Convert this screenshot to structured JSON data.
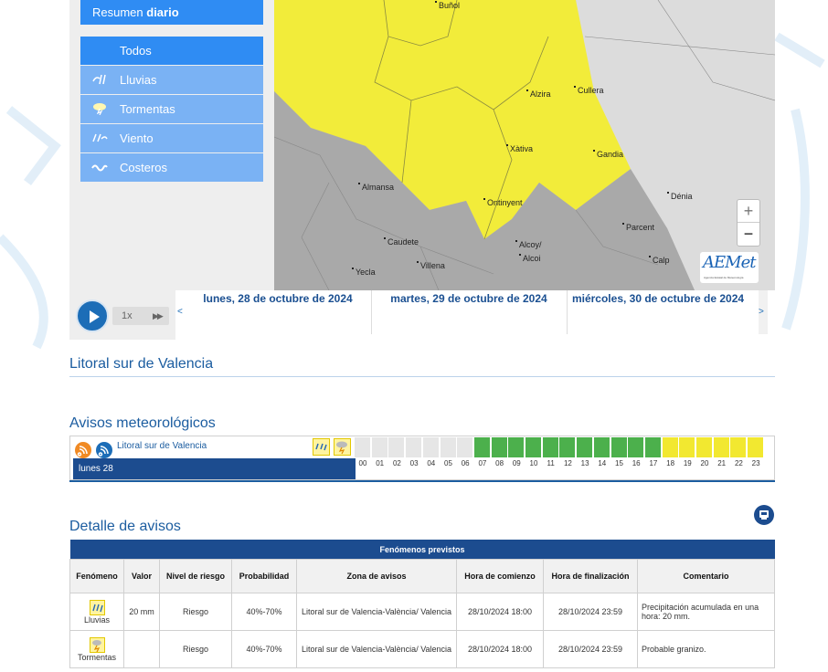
{
  "sidebar": {
    "summary_prefix": "Resumen ",
    "summary_bold": "diario",
    "items": [
      {
        "label": "Todos",
        "icon": "",
        "active": true
      },
      {
        "label": "Lluvias",
        "icon": "rain-icon"
      },
      {
        "label": "Tormentas",
        "icon": "storm-icon"
      },
      {
        "label": "Viento",
        "icon": "wind-icon"
      },
      {
        "label": "Costeros",
        "icon": "coastal-icon"
      }
    ]
  },
  "map": {
    "cities": [
      {
        "name": "Buñol"
      },
      {
        "name": "Alzira"
      },
      {
        "name": "Cullera"
      },
      {
        "name": "Xàtiva"
      },
      {
        "name": "Gandia"
      },
      {
        "name": "Almansa"
      },
      {
        "name": "Ontinyent"
      },
      {
        "name": "Dénia"
      },
      {
        "name": "Parcent"
      },
      {
        "name": "Caudete"
      },
      {
        "name": "Alcoy/"
      },
      {
        "name": "Alcoi"
      },
      {
        "name": "Villena"
      },
      {
        "name": "Yecla"
      },
      {
        "name": "Calp"
      }
    ],
    "zoom_in": "+",
    "zoom_out": "−",
    "logo_text": "AEMet",
    "logo_sub": "Agencia Estatal de Meteorología"
  },
  "timeline": {
    "speed": "1x",
    "ff": "▶▶",
    "prev": "<",
    "next": ">",
    "days": [
      "lunes, 28 de octubre de 2024",
      "martes, 29 de octubre de 2024",
      "miércoles, 30 de octubre de 2024"
    ]
  },
  "region_title": "Litoral sur de Valencia",
  "avisos": {
    "title": "Avisos meteorológicos",
    "location": "Litoral sur de Valencia",
    "day_label": "lunes 28",
    "hours": [
      "00",
      "01",
      "02",
      "03",
      "04",
      "05",
      "06",
      "07",
      "08",
      "09",
      "10",
      "11",
      "12",
      "13",
      "14",
      "15",
      "16",
      "17",
      "18",
      "19",
      "20",
      "21",
      "22",
      "23"
    ],
    "levels": [
      "none",
      "none",
      "none",
      "none",
      "none",
      "none",
      "none",
      "green",
      "green",
      "green",
      "green",
      "green",
      "green",
      "green",
      "green",
      "green",
      "green",
      "green",
      "yellow",
      "yellow",
      "yellow",
      "yellow",
      "yellow",
      "yellow"
    ],
    "colors": {
      "none": "#e6e6e6",
      "green": "#4cb04c",
      "yellow": "#f2e830"
    }
  },
  "detail": {
    "title": "Detalle de avisos",
    "table_title": "Fenómenos previstos",
    "headers": [
      "Fenómeno",
      "Valor",
      "Nivel de riesgo",
      "Probabilidad",
      "Zona de avisos",
      "Hora de comienzo",
      "Hora de finalización",
      "Comentario"
    ],
    "rows": [
      {
        "phenomenon": "Lluvias",
        "icon": "rain-icon",
        "value": "20 mm",
        "risk": "Riesgo",
        "prob": "40%-70%",
        "zone": "Litoral sur de Valencia-València/ Valencia",
        "start": "28/10/2024 18:00",
        "end": "28/10/2024 23:59",
        "comment": "Precipitación acumulada en una hora: 20 mm."
      },
      {
        "phenomenon": "Tormentas",
        "icon": "storm-icon",
        "value": "",
        "risk": "Riesgo",
        "prob": "40%-70%",
        "zone": "Litoral sur de Valencia-València/ Valencia",
        "start": "28/10/2024 18:00",
        "end": "28/10/2024 23:59",
        "comment": "Probable granizo."
      }
    ]
  }
}
